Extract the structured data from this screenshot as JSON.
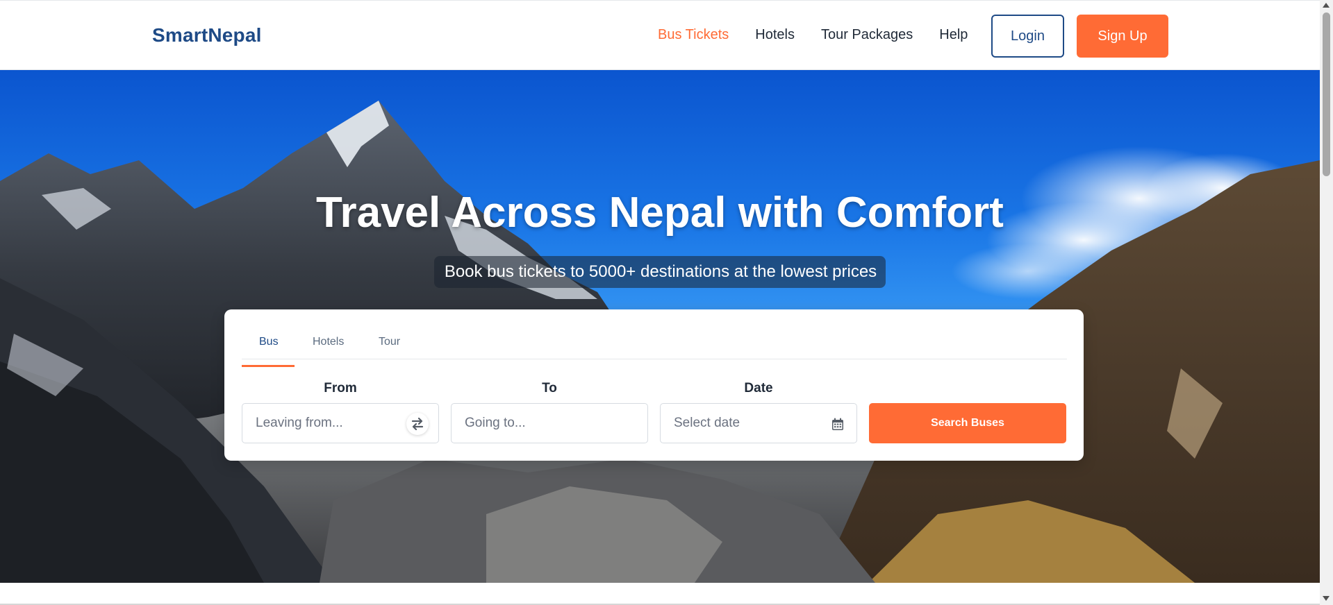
{
  "brand": {
    "name": "SmartNepal",
    "color": "#1e4a86",
    "accent": "#ff6b35"
  },
  "nav": {
    "links": [
      {
        "label": "Bus Tickets",
        "active": true
      },
      {
        "label": "Hotels",
        "active": false
      },
      {
        "label": "Tour Packages",
        "active": false
      },
      {
        "label": "Help",
        "active": false
      }
    ],
    "login_label": "Login",
    "signup_label": "Sign Up"
  },
  "hero": {
    "title": "Travel Across Nepal with Comfort",
    "subtitle": "Book bus tickets to 5000+ destinations at the lowest prices"
  },
  "search": {
    "tabs": [
      {
        "label": "Bus",
        "active": true
      },
      {
        "label": "Hotels",
        "active": false
      },
      {
        "label": "Tour",
        "active": false
      }
    ],
    "from": {
      "label": "From",
      "placeholder": "Leaving from..."
    },
    "to": {
      "label": "To",
      "placeholder": "Going to..."
    },
    "date": {
      "label": "Date",
      "placeholder": "Select date"
    },
    "submit_label": "Search Buses",
    "icons": {
      "swap": "swap-arrows-icon",
      "calendar": "calendar-icon"
    }
  }
}
